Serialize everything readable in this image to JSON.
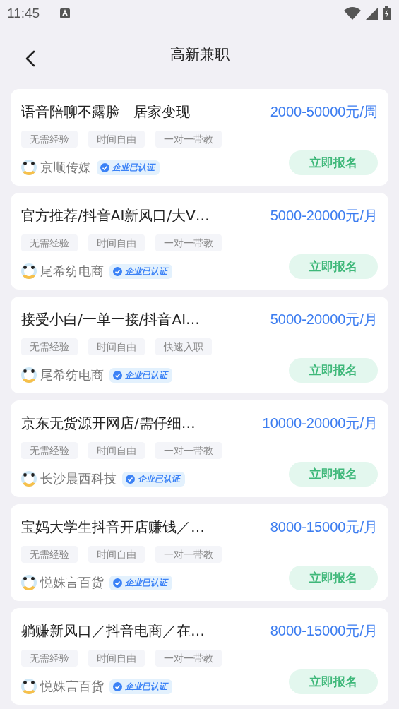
{
  "status_bar": {
    "time": "11:45"
  },
  "header": {
    "title": "高新兼职"
  },
  "jobs": [
    {
      "title": "语音陪聊不露脸   居家变现",
      "salary": "2000-50000元/周",
      "tags": [
        "无需经验",
        "时间自由",
        "一对一带教"
      ],
      "company": "京顺传媒",
      "verified": true,
      "verified_label": "企业已认证",
      "action": "立即报名"
    },
    {
      "title": "官方推荐/抖音AI新风口/大V…",
      "salary": "5000-20000元/月",
      "tags": [
        "无需经验",
        "时间自由",
        "一对一带教"
      ],
      "company": "尾希纺电商",
      "verified": true,
      "verified_label": "企业已认证",
      "action": "立即报名"
    },
    {
      "title": "接受小白/一单一接/抖音AI…",
      "salary": "5000-20000元/月",
      "tags": [
        "无需经验",
        "时间自由",
        "快速入职"
      ],
      "company": "尾希纺电商",
      "verified": true,
      "verified_label": "企业已认证",
      "action": "立即报名"
    },
    {
      "title": "京东无货源开网店/需仔细…",
      "salary": "10000-20000元/月",
      "tags": [
        "无需经验",
        "时间自由",
        "一对一带教"
      ],
      "company": "长沙晨西科技",
      "verified": true,
      "verified_label": "企业已认证",
      "action": "立即报名"
    },
    {
      "title": "宝妈大学生抖音开店赚钱／…",
      "salary": "8000-15000元/月",
      "tags": [
        "无需经验",
        "时间自由",
        "一对一带教"
      ],
      "company": "悦姝言百货",
      "verified": true,
      "verified_label": "企业已认证",
      "action": "立即报名"
    },
    {
      "title": "躺赚新风口／抖音电商／在…",
      "salary": "8000-15000元/月",
      "tags": [
        "无需经验",
        "时间自由",
        "一对一带教"
      ],
      "company": "悦姝言百货",
      "verified": true,
      "verified_label": "企业已认证",
      "action": "立即报名"
    }
  ]
}
